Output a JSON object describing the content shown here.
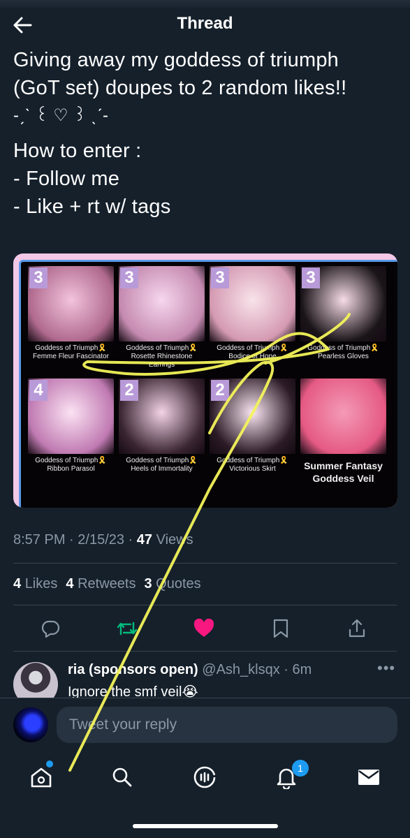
{
  "header": {
    "title": "Thread"
  },
  "tweet": {
    "lines": [
      "Giving away my goddess of triumph",
      "(GoT set) doupes to 2 random likes!!",
      "-ˏˋ ꒰ ♡ ꒱ ˎˊ-",
      "How to enter :",
      "- Follow me",
      "- Like + rt w/ tags"
    ],
    "time": "8:57 PM",
    "date": "2/15/23",
    "views_count": "47",
    "views_label": "Views"
  },
  "media": {
    "items": [
      {
        "badge": "3",
        "caption": "Goddess of Triumph🎗️Femme Fleur Fascinator",
        "c1": "#f3c3dd",
        "c2": "#b06a8e"
      },
      {
        "badge": "3",
        "caption": "Goddess of Triumph🎗️Rosette Rhinestone Earrings",
        "c1": "#f6d7ee",
        "c2": "#c58ab0"
      },
      {
        "badge": "3",
        "caption": "Goddess of Triumph🎗️Bodice of Hope",
        "c1": "#f9e3ea",
        "c2": "#d49ab2"
      },
      {
        "badge": "3",
        "caption": "Goddess of Triumph🎗️Pearless Gloves",
        "c1": "#f7dce6",
        "c2": "#1a1418"
      },
      {
        "badge": "4",
        "caption": "Goddess of Triumph🎗️Ribbon Parasol",
        "c1": "#fbe2f3",
        "c2": "#c07ab2"
      },
      {
        "badge": "2",
        "caption": "Goddess of Triumph🎗️Heels of Immortality",
        "c1": "#f2d3e6",
        "c2": "#3a2532"
      },
      {
        "badge": "2",
        "caption": "Goddess of Triumph🎗️Victorious Skirt",
        "c1": "#fae6f2",
        "c2": "#2b1b26"
      },
      {
        "badge": "",
        "caption": "Summer Fantasy Goddess Veil",
        "c1": "#f49ab6",
        "c2": "#e55a84"
      }
    ]
  },
  "stats": [
    {
      "count": "4",
      "label": "Likes"
    },
    {
      "count": "4",
      "label": "Retweets"
    },
    {
      "count": "3",
      "label": "Quotes"
    }
  ],
  "actions": {
    "reply_icon": "comment-icon",
    "retweet_icon": "retweet-icon",
    "like_icon": "heart-icon",
    "bookmark_icon": "bookmark-icon",
    "share_icon": "share-icon",
    "like_color": "#f91880",
    "retweet_color": "#00ba7c"
  },
  "reply": {
    "name": "ria (sponsors open)",
    "handle": "@Ash_klsqx",
    "time": "6m",
    "body": "Ignore the smf veil😭",
    "more": "•••"
  },
  "composer": {
    "placeholder": "Tweet your reply"
  },
  "tabbar": {
    "notifications_count": "1"
  },
  "colors": {
    "background": "#15202b",
    "accent": "#1d9bf0",
    "muted": "#8b98a5",
    "scribble": "#f3f35a"
  }
}
